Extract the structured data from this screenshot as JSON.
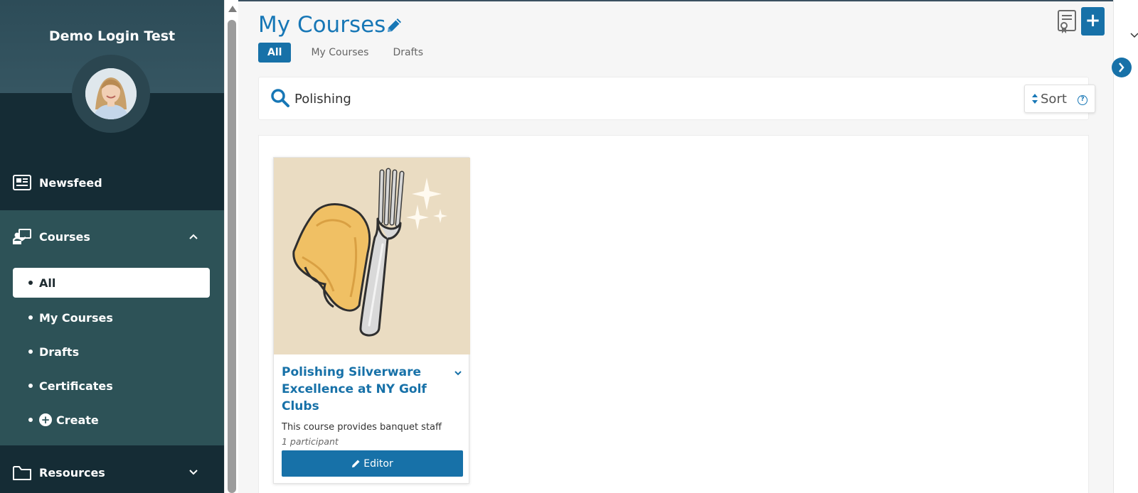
{
  "sidebar": {
    "user_name": "Demo Login Test",
    "items": {
      "newsfeed": "Newsfeed",
      "courses": "Courses",
      "resources": "Resources"
    },
    "courses_sub": {
      "all": "All",
      "my_courses": "My Courses",
      "drafts": "Drafts",
      "certificates": "Certificates",
      "create": "Create"
    }
  },
  "header": {
    "title": "My Courses",
    "tabs": {
      "all": "All",
      "my_courses": "My Courses",
      "drafts": "Drafts"
    },
    "add_label": "+"
  },
  "search": {
    "value": "Polishing",
    "sort_label": "Sort",
    "help_label": "?"
  },
  "course_card": {
    "title": "Polishing Silverware Excellence at NY Golf Clubs",
    "description": "This course provides banquet staff",
    "participants": "1 participant",
    "editor_label": "Editor"
  },
  "colors": {
    "accent": "#1771a8",
    "sidebar_dark": "#152c35",
    "sidebar_courses": "#2d5257"
  }
}
